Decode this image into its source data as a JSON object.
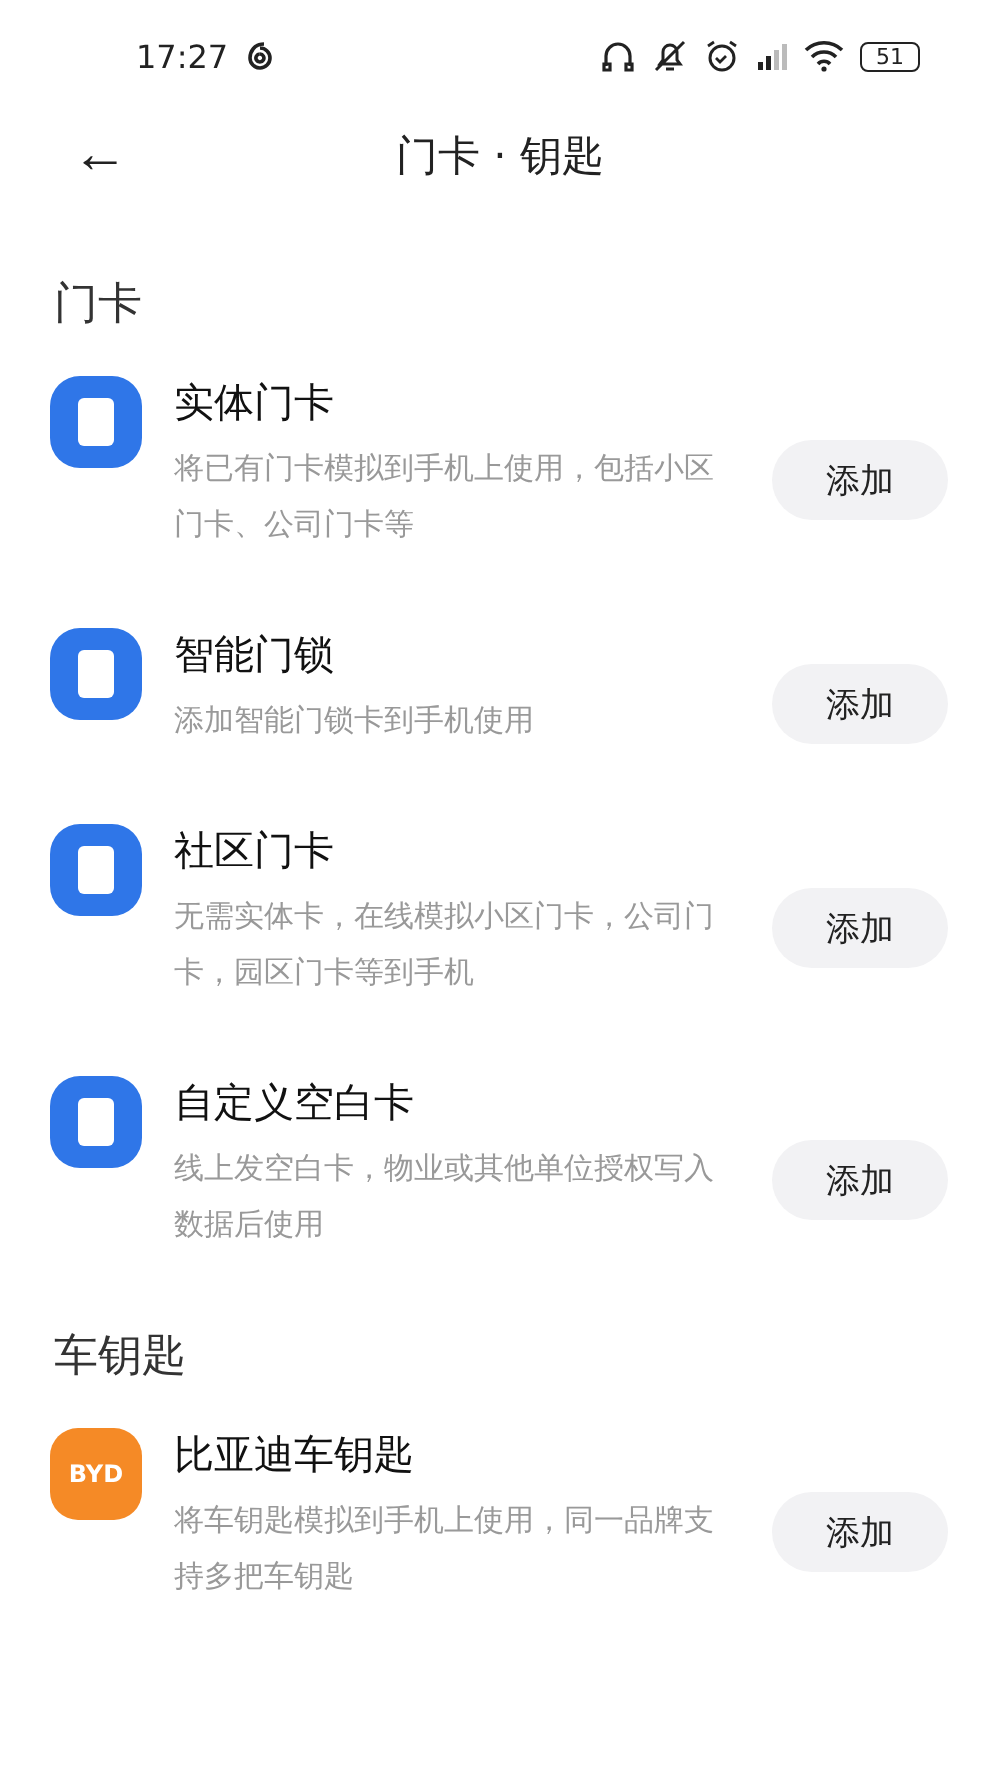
{
  "status_bar": {
    "time": "17:27",
    "battery": "51"
  },
  "header": {
    "back": "←",
    "title": "门卡 · 钥匙"
  },
  "sections": [
    {
      "title": "门卡",
      "items": [
        {
          "kind": "card",
          "title": "实体门卡",
          "description": "将已有门卡模拟到手机上使用，包括小区门卡、公司门卡等",
          "button": "添加"
        },
        {
          "kind": "card",
          "title": "智能门锁",
          "description": "添加智能门锁卡到手机使用",
          "button": "添加"
        },
        {
          "kind": "card",
          "title": "社区门卡",
          "description": "无需实体卡，在线模拟小区门卡，公司门卡，园区门卡等到手机",
          "button": "添加"
        },
        {
          "kind": "card",
          "title": "自定义空白卡",
          "description": "线上发空白卡，物业或其他单位授权写入数据后使用",
          "button": "添加"
        }
      ]
    },
    {
      "title": "车钥匙",
      "items": [
        {
          "kind": "brand",
          "logo_text": "BYD",
          "title": "比亚迪车钥匙",
          "description": "将车钥匙模拟到手机上使用，同一品牌支持多把车钥匙",
          "button": "添加"
        }
      ]
    }
  ]
}
